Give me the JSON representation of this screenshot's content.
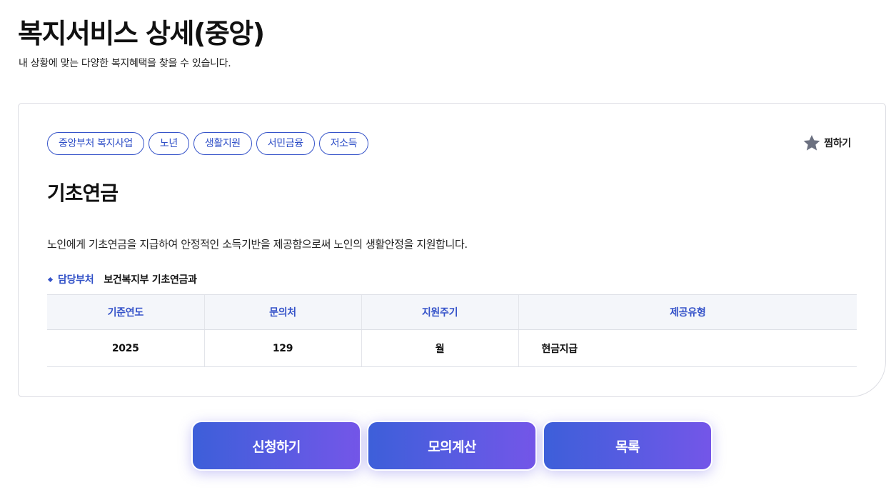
{
  "header": {
    "title": "복지서비스 상세(중앙)",
    "subtitle": "내 상황에 맞는 다양한 복지혜택을 찾을 수 있습니다."
  },
  "service": {
    "tags": [
      "중앙부처 복지사업",
      "노년",
      "생활지원",
      "서민금융",
      "저소득"
    ],
    "favorite_label": "찜하기",
    "favorite_icon": "star-icon",
    "title": "기초연금",
    "description": "노인에게 기초연금을 지급하여 안정적인 소득기반을 제공함으로써 노인의 생활안정을 지원합니다.",
    "department_label": "담당부처",
    "department_value": "보건복지부 기초연금과"
  },
  "info_table": {
    "headers": [
      "기준연도",
      "문의처",
      "지원주기",
      "제공유형"
    ],
    "row": [
      "2025",
      "129",
      "월",
      "현금지급"
    ]
  },
  "actions": {
    "apply_label": "신청하기",
    "simulate_label": "모의계산",
    "list_label": "목록"
  },
  "colors": {
    "accent": "#3553c9",
    "button_gradient_start": "#3d5fd9",
    "button_gradient_end": "#7456e8",
    "star": "#6b7080"
  }
}
